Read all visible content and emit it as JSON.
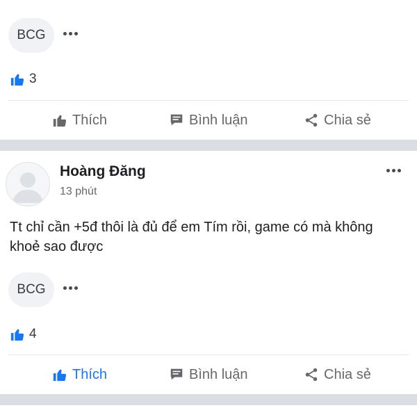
{
  "posts": [
    {
      "chip": "BCG",
      "like_count": "3",
      "actions": {
        "like": "Thích",
        "comment": "Bình luận",
        "share": "Chia sẻ"
      }
    },
    {
      "author": "Hoàng Đăng",
      "time": "13 phút",
      "text": "Tt chỉ cần +5đ thôi là đủ để em Tím rồi, game có mà không khoẻ sao được",
      "chip": "BCG",
      "like_count": "4",
      "actions": {
        "like": "Thích",
        "comment": "Bình luận",
        "share": "Chia sẻ"
      },
      "liked": true
    }
  ],
  "colors": {
    "accent": "#1877f2",
    "muted": "#65676b",
    "separator": "#dadde1"
  },
  "icons": [
    "like-icon",
    "comment-icon",
    "share-icon",
    "more-options-icon",
    "default-avatar-icon"
  ]
}
